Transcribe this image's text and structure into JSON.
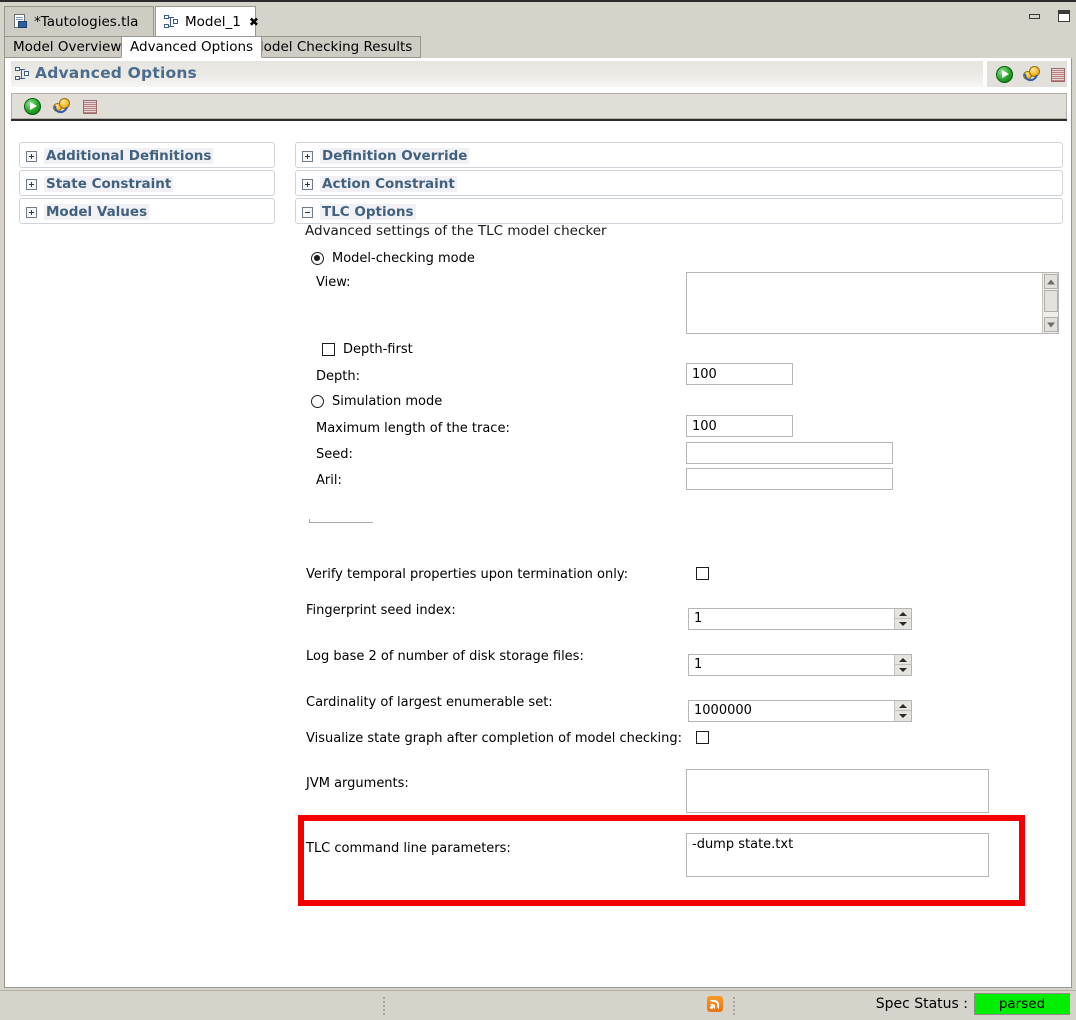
{
  "window": {
    "minimize_label": "minimize",
    "maximize_label": "restore"
  },
  "editor_tabs": [
    {
      "label": "*Tautologies.tla",
      "icon": "tla-file-icon",
      "active": false
    },
    {
      "label": "Model_1",
      "icon": "model-icon",
      "active": true,
      "close": "✖"
    }
  ],
  "form_tabs": [
    {
      "label": "Model Overview",
      "active": false
    },
    {
      "label": "Advanced Options",
      "active": true
    },
    {
      "label": "Model Checking Results",
      "active": false
    }
  ],
  "form": {
    "title": "Advanced Options",
    "header_icon": "model-icon",
    "toolbar": [
      {
        "name": "run-model-button",
        "icon": "green-play-icon"
      },
      {
        "name": "run-trace-explorer-button",
        "icon": "gears-icon"
      },
      {
        "name": "stop-button",
        "icon": "stop-icon"
      }
    ]
  },
  "left_sections": [
    {
      "label": "Additional Definitions",
      "state": "collapsed"
    },
    {
      "label": "State Constraint",
      "state": "collapsed"
    },
    {
      "label": "Model Values",
      "state": "collapsed"
    }
  ],
  "right_sections": [
    {
      "label": "Definition Override",
      "state": "collapsed"
    },
    {
      "label": "Action Constraint",
      "state": "collapsed"
    },
    {
      "label": "TLC Options",
      "state": "expanded"
    }
  ],
  "tlc": {
    "subtitle": "Advanced settings of the TLC model checker",
    "model_checking_mode": {
      "label": "Model-checking mode",
      "selected": true
    },
    "view": {
      "label": "View:",
      "value": ""
    },
    "depth_first": {
      "label": "Depth-first",
      "checked": false
    },
    "depth": {
      "label": "Depth:",
      "value": "100"
    },
    "simulation_mode": {
      "label": "Simulation mode",
      "selected": false
    },
    "max_trace": {
      "label": "Maximum length of the trace:",
      "value": "100"
    },
    "seed": {
      "label": "Seed:",
      "value": ""
    },
    "aril": {
      "label": "Aril:",
      "value": ""
    },
    "verify_temporal": {
      "label": "Verify temporal properties upon termination only:",
      "checked": false
    },
    "fingerprint_seed": {
      "label": "Fingerprint seed index:",
      "value": "1"
    },
    "log_base_2": {
      "label": "Log base 2 of number of disk storage files:",
      "value": "1"
    },
    "cardinality": {
      "label": "Cardinality of largest enumerable set:",
      "value": "1000000"
    },
    "visualize_graph": {
      "label": "Visualize state graph after completion of model checking:",
      "checked": false
    },
    "jvm_args": {
      "label": "JVM arguments:",
      "value": ""
    },
    "tlc_params": {
      "label": "TLC command line parameters:",
      "value": "-dump state.txt"
    }
  },
  "annotation": {
    "color": "#f40000",
    "target": "tlc-command-line-parameters-row"
  },
  "status": {
    "spec_status_label": "Spec Status :",
    "spec_status_value": "parsed",
    "spec_status_color": "#00ef00",
    "rss_icon": "rss-icon"
  }
}
